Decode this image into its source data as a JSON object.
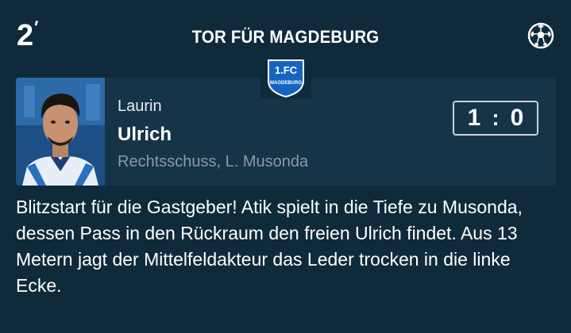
{
  "event": {
    "minute": "2",
    "title": "TOR FÜR MAGDEBURG",
    "icon": "soccer-ball-icon"
  },
  "team": {
    "logo_text_top": "1.FC",
    "logo_text_bottom": "MAGDEBURG",
    "logo_color": "#1565c0"
  },
  "player": {
    "first_name": "Laurin",
    "last_name": "Ulrich",
    "detail": "Rechtsschuss, L. Musonda"
  },
  "score": {
    "home": "1",
    "separator": ":",
    "away": "0"
  },
  "description": "Blitzstart für die Gastgeber! Atik spielt in die Tiefe zu Musonda, dessen Pass in den Rückraum den freien Ulrich findet. Aus 13 Metern jagt der Mittelfeldakteur das Leder trocken in die linke Ecke.",
  "colors": {
    "background": "#0f2a3b",
    "card": "#163447",
    "muted_text": "#8b9aa6"
  }
}
